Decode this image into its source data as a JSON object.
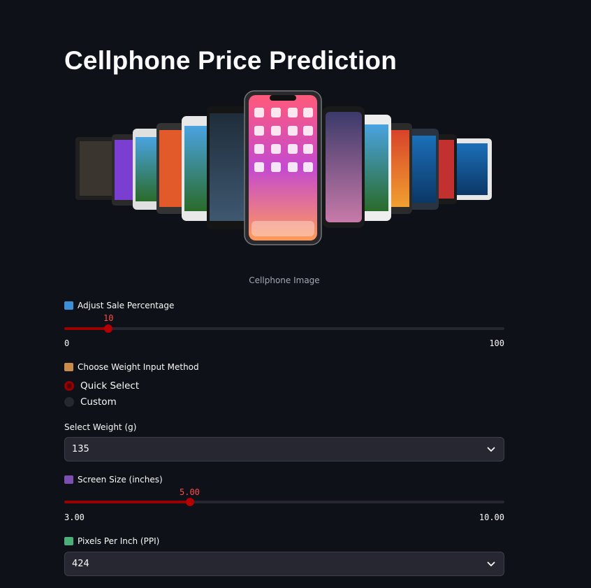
{
  "app": {
    "title": "Cellphone Price Prediction",
    "image_caption": "Cellphone Image"
  },
  "sale": {
    "icon": "shopping-bags-icon",
    "label": "Adjust Sale Percentage",
    "value": "10",
    "min": "0",
    "max": "100",
    "fraction": 0.1
  },
  "weight_method": {
    "icon": "package-icon",
    "label": "Choose Weight Input Method",
    "options": [
      "Quick Select",
      "Custom"
    ],
    "selected": "Quick Select"
  },
  "weight": {
    "label": "Select Weight (g)",
    "value": "135"
  },
  "screen": {
    "icon": "abacus-icon",
    "label": "Screen Size (inches)",
    "value": "5.00",
    "min": "3.00",
    "max": "10.00",
    "fraction": 0.2857
  },
  "ppi": {
    "icon": "picture-icon",
    "label": "Pixels Per Inch (PPI)",
    "value": "424"
  },
  "colors": {
    "accent": "#ff4b4b",
    "accent_dark": "#990000",
    "bg": "#0e1117",
    "widget": "#262730"
  }
}
